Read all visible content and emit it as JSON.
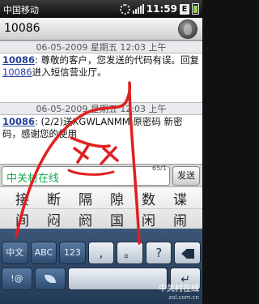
{
  "status": {
    "carrier": "中国移动",
    "time": "11:59",
    "network_badge": "E"
  },
  "header": {
    "title": "10086"
  },
  "messages": [
    {
      "date": "06-05-2009 星期五 12:03 上午",
      "sender": "10086",
      "body_1": ": 尊敬的客户，您发送的代码有误。回复",
      "link": "10086",
      "body_2": "进入短信营业厅。"
    },
    {
      "date": "06-05-2009 星期五 12:03 上午",
      "sender": "10086",
      "body_1": ": (2/2)送XGWLANMM 原密码 新密码，感谢您的使用"
    }
  ],
  "compose": {
    "input_text": "中关村在线",
    "counter": "65/1",
    "send_label": "发送"
  },
  "candidates": {
    "row1": [
      "接",
      "断",
      "隔",
      "隙",
      "数",
      "谍"
    ],
    "row2": [
      "间",
      "闷",
      "阏",
      "国",
      "闲",
      "闹"
    ]
  },
  "keyboard": {
    "row1": [
      "?!",
      "abc",
      "",
      ",",
      "。",
      "?",
      "delete"
    ],
    "mode_cn": "中文",
    "abc": "ABC",
    "num": "123",
    "comma": ",",
    "period": "。",
    "question": "?",
    "symbols": "!@",
    "space": "",
    "enter": "enter"
  },
  "watermark": {
    "line1": "中关村在线",
    "line2": "zol.com.cn"
  },
  "colors": {
    "link": "#243f99",
    "input_text": "#18a84f",
    "keyboard_bg": "#2b4566",
    "scribble": "#e02020"
  }
}
